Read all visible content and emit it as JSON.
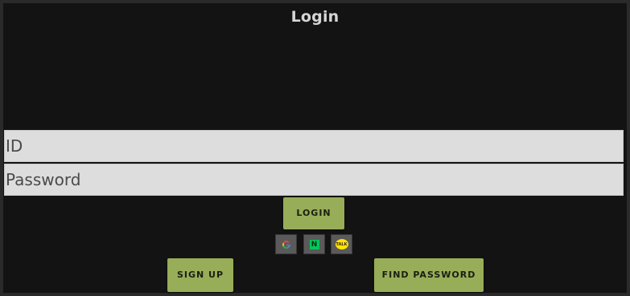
{
  "header": {
    "title": "Login"
  },
  "form": {
    "id_placeholder": "ID",
    "password_placeholder": "Password",
    "login_label": "LOGIN"
  },
  "social": {
    "google_icon": "google-icon",
    "naver_icon": "naver-icon",
    "naver_letter": "N",
    "kakao_icon": "kakao-icon",
    "kakao_text": "TALK"
  },
  "footer": {
    "signup_label": "SIGN UP",
    "find_password_label": "FIND PASSWORD"
  },
  "colors": {
    "background": "#131313",
    "button": "#97ad58",
    "field": "#dddddd",
    "naver": "#03c75a",
    "kakao": "#fee500"
  }
}
